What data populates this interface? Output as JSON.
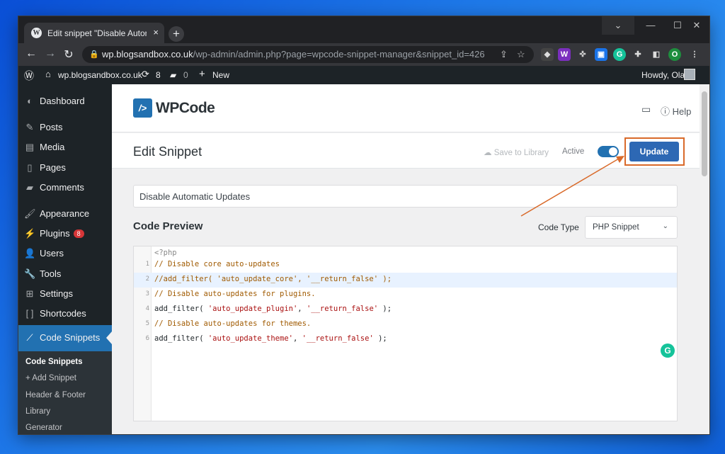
{
  "browser": {
    "tab_title": "Edit snippet \"Disable Automatic U",
    "tab_close": "×",
    "new_tab": "+",
    "url_host": "wp.blogsandbox.co.uk",
    "url_path": "/wp-admin/admin.php?page=wpcode-snippet-manager&snippet_id=426",
    "profile_initial": "O"
  },
  "adminbar": {
    "site_name": "wp.blogsandbox.co.uk",
    "updates_count": "8",
    "comments_count": "0",
    "new_label": "New",
    "howdy": "Howdy, Ola"
  },
  "sidebar": {
    "items": [
      {
        "label": "Dashboard",
        "icon": "dashboard-icon"
      },
      {
        "label": "Posts",
        "icon": "pin-icon"
      },
      {
        "label": "Media",
        "icon": "media-icon"
      },
      {
        "label": "Pages",
        "icon": "page-icon"
      },
      {
        "label": "Comments",
        "icon": "comment-icon"
      },
      {
        "label": "Appearance",
        "icon": "brush-icon"
      },
      {
        "label": "Plugins",
        "icon": "plug-icon",
        "badge": "8"
      },
      {
        "label": "Users",
        "icon": "user-icon"
      },
      {
        "label": "Tools",
        "icon": "wrench-icon"
      },
      {
        "label": "Settings",
        "icon": "settings-icon"
      },
      {
        "label": "Shortcodes",
        "icon": "brackets-icon"
      },
      {
        "label": "Code Snippets",
        "icon": "wpcode-icon",
        "active": true
      }
    ],
    "submenu": [
      "Code Snippets",
      "+ Add Snippet",
      "Header & Footer",
      "Library",
      "Generator"
    ]
  },
  "wpcode": {
    "logo": "WPCode",
    "logo_mark": "/>",
    "help_label": "Help",
    "page_title": "Edit Snippet",
    "save_to_library": "Save to Library",
    "active_label": "Active",
    "active_on": true,
    "update_label": "Update",
    "snippet_title": "Disable Automatic Updates",
    "code_preview_label": "Code Preview",
    "code_type_label": "Code Type",
    "code_type_value": "PHP Snippet"
  },
  "code": {
    "open_tag": "<?php",
    "lines": [
      {
        "n": "1",
        "text": "// Disable core auto-updates",
        "kind": "comment"
      },
      {
        "n": "2",
        "text": "//add_filter( 'auto_update_core', '__return_false' );",
        "kind": "comment"
      },
      {
        "n": "3",
        "text": "// Disable auto-updates for plugins.",
        "kind": "comment"
      },
      {
        "n": "4",
        "pre": "add_filter( ",
        "s1": "'auto_update_plugin'",
        "mid": ", ",
        "s2": "'__return_false'",
        "post": " );",
        "kind": "call"
      },
      {
        "n": "5",
        "text": "// Disable auto-updates for themes.",
        "kind": "comment"
      },
      {
        "n": "6",
        "pre": "add_filter( ",
        "s1": "'auto_update_theme'",
        "mid": ", ",
        "s2": "'__return_false'",
        "post": " );",
        "kind": "call"
      }
    ]
  },
  "colors": {
    "accent": "#2271b1",
    "highlight_box": "#d96a2a",
    "admin_bg": "#1d2327"
  }
}
